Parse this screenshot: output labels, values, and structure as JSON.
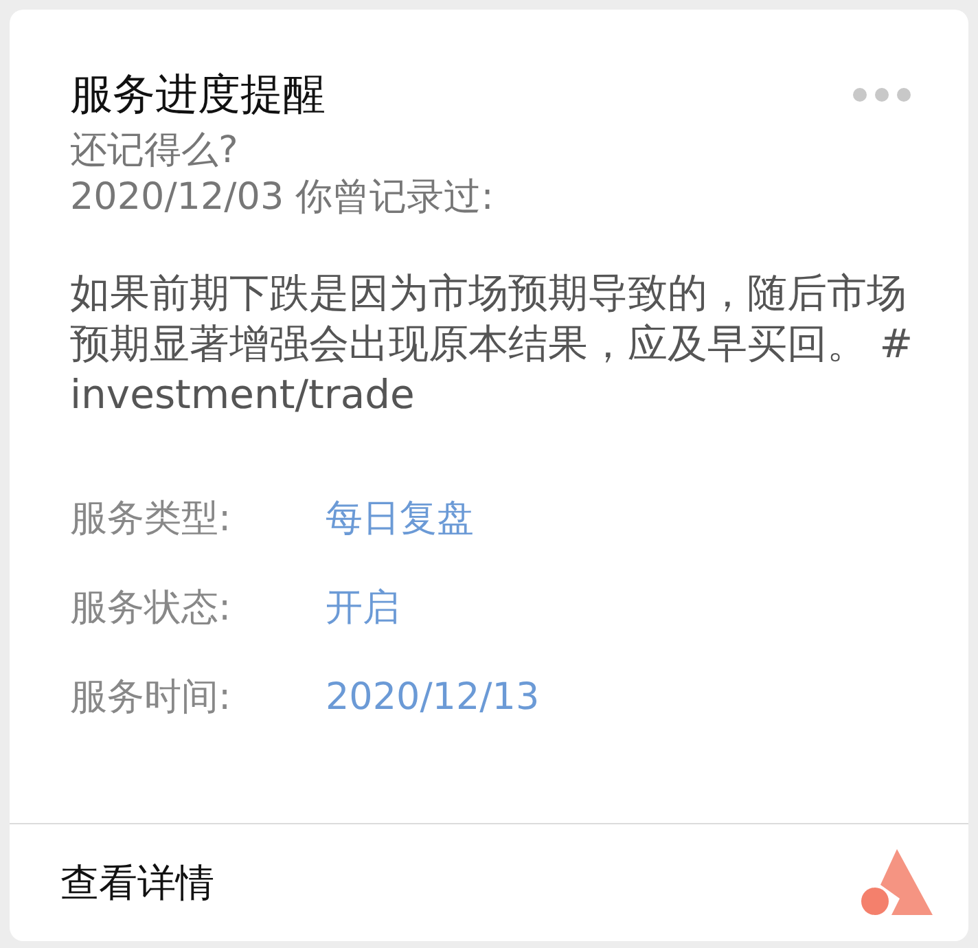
{
  "card": {
    "title": "服务进度提醒",
    "intro": [
      "还记得么?",
      "2020/12/03 你曾记录过:"
    ],
    "message": "如果前期下跌是因为市场预期导致的，随后市场预期显著增强会出现原本结果，应及早买回。 #investment/trade",
    "details": [
      {
        "label": "服务类型:",
        "value": "每日复盘"
      },
      {
        "label": "服务状态:",
        "value": "开启"
      },
      {
        "label": "服务时间:",
        "value": "2020/12/13"
      }
    ],
    "footer_link": "查看详情"
  }
}
